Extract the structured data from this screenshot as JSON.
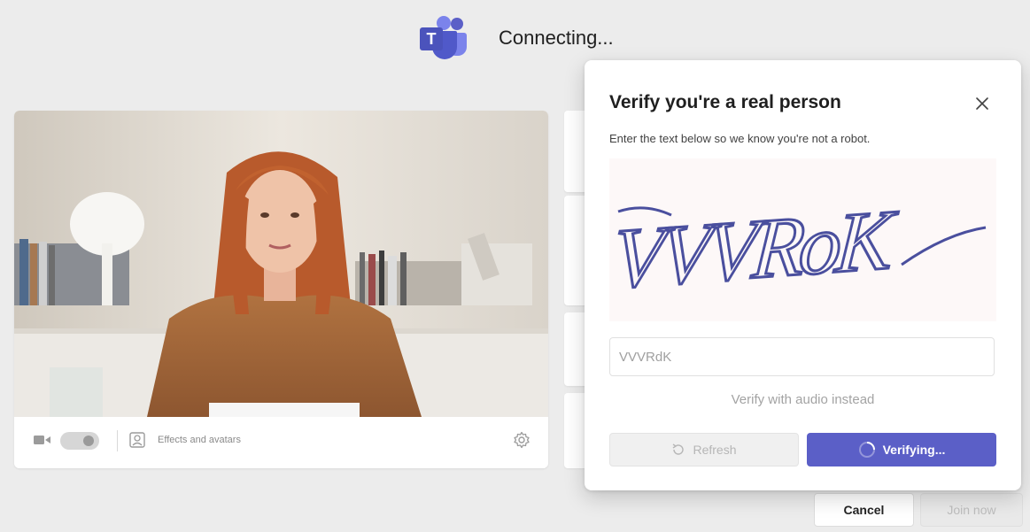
{
  "header": {
    "title": "Connecting...",
    "logo_icon": "teams-logo-icon"
  },
  "video": {
    "effects_label": "Effects and avatars",
    "camera_toggle": "off"
  },
  "footer": {
    "cancel_label": "Cancel",
    "join_label": "Join now"
  },
  "dialog": {
    "title": "Verify you're a real person",
    "subtitle": "Enter the text below so we know you're not a robot.",
    "captcha_text": "VVVRoK",
    "input_value": "VVVRdK",
    "audio_link": "Verify with audio instead",
    "refresh_label": "Refresh",
    "verify_label": "Verifying..."
  },
  "colors": {
    "accent": "#5b5fc7",
    "background": "#ececec",
    "captcha_bg": "#fdf8f8"
  }
}
